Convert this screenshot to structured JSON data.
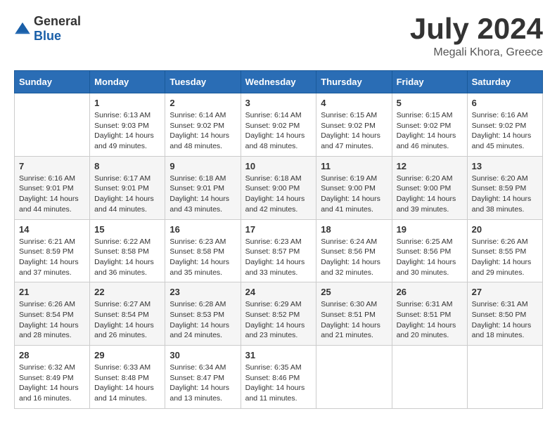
{
  "header": {
    "logo": {
      "general": "General",
      "blue": "Blue"
    },
    "title": "July 2024",
    "location": "Megali Khora, Greece"
  },
  "weekdays": [
    "Sunday",
    "Monday",
    "Tuesday",
    "Wednesday",
    "Thursday",
    "Friday",
    "Saturday"
  ],
  "weeks": [
    [
      {
        "day": "",
        "sunrise": "",
        "sunset": "",
        "daylight": ""
      },
      {
        "day": "1",
        "sunrise": "Sunrise: 6:13 AM",
        "sunset": "Sunset: 9:03 PM",
        "daylight": "Daylight: 14 hours and 49 minutes."
      },
      {
        "day": "2",
        "sunrise": "Sunrise: 6:14 AM",
        "sunset": "Sunset: 9:02 PM",
        "daylight": "Daylight: 14 hours and 48 minutes."
      },
      {
        "day": "3",
        "sunrise": "Sunrise: 6:14 AM",
        "sunset": "Sunset: 9:02 PM",
        "daylight": "Daylight: 14 hours and 48 minutes."
      },
      {
        "day": "4",
        "sunrise": "Sunrise: 6:15 AM",
        "sunset": "Sunset: 9:02 PM",
        "daylight": "Daylight: 14 hours and 47 minutes."
      },
      {
        "day": "5",
        "sunrise": "Sunrise: 6:15 AM",
        "sunset": "Sunset: 9:02 PM",
        "daylight": "Daylight: 14 hours and 46 minutes."
      },
      {
        "day": "6",
        "sunrise": "Sunrise: 6:16 AM",
        "sunset": "Sunset: 9:02 PM",
        "daylight": "Daylight: 14 hours and 45 minutes."
      }
    ],
    [
      {
        "day": "7",
        "sunrise": "Sunrise: 6:16 AM",
        "sunset": "Sunset: 9:01 PM",
        "daylight": "Daylight: 14 hours and 44 minutes."
      },
      {
        "day": "8",
        "sunrise": "Sunrise: 6:17 AM",
        "sunset": "Sunset: 9:01 PM",
        "daylight": "Daylight: 14 hours and 44 minutes."
      },
      {
        "day": "9",
        "sunrise": "Sunrise: 6:18 AM",
        "sunset": "Sunset: 9:01 PM",
        "daylight": "Daylight: 14 hours and 43 minutes."
      },
      {
        "day": "10",
        "sunrise": "Sunrise: 6:18 AM",
        "sunset": "Sunset: 9:00 PM",
        "daylight": "Daylight: 14 hours and 42 minutes."
      },
      {
        "day": "11",
        "sunrise": "Sunrise: 6:19 AM",
        "sunset": "Sunset: 9:00 PM",
        "daylight": "Daylight: 14 hours and 41 minutes."
      },
      {
        "day": "12",
        "sunrise": "Sunrise: 6:20 AM",
        "sunset": "Sunset: 9:00 PM",
        "daylight": "Daylight: 14 hours and 39 minutes."
      },
      {
        "day": "13",
        "sunrise": "Sunrise: 6:20 AM",
        "sunset": "Sunset: 8:59 PM",
        "daylight": "Daylight: 14 hours and 38 minutes."
      }
    ],
    [
      {
        "day": "14",
        "sunrise": "Sunrise: 6:21 AM",
        "sunset": "Sunset: 8:59 PM",
        "daylight": "Daylight: 14 hours and 37 minutes."
      },
      {
        "day": "15",
        "sunrise": "Sunrise: 6:22 AM",
        "sunset": "Sunset: 8:58 PM",
        "daylight": "Daylight: 14 hours and 36 minutes."
      },
      {
        "day": "16",
        "sunrise": "Sunrise: 6:23 AM",
        "sunset": "Sunset: 8:58 PM",
        "daylight": "Daylight: 14 hours and 35 minutes."
      },
      {
        "day": "17",
        "sunrise": "Sunrise: 6:23 AM",
        "sunset": "Sunset: 8:57 PM",
        "daylight": "Daylight: 14 hours and 33 minutes."
      },
      {
        "day": "18",
        "sunrise": "Sunrise: 6:24 AM",
        "sunset": "Sunset: 8:56 PM",
        "daylight": "Daylight: 14 hours and 32 minutes."
      },
      {
        "day": "19",
        "sunrise": "Sunrise: 6:25 AM",
        "sunset": "Sunset: 8:56 PM",
        "daylight": "Daylight: 14 hours and 30 minutes."
      },
      {
        "day": "20",
        "sunrise": "Sunrise: 6:26 AM",
        "sunset": "Sunset: 8:55 PM",
        "daylight": "Daylight: 14 hours and 29 minutes."
      }
    ],
    [
      {
        "day": "21",
        "sunrise": "Sunrise: 6:26 AM",
        "sunset": "Sunset: 8:54 PM",
        "daylight": "Daylight: 14 hours and 28 minutes."
      },
      {
        "day": "22",
        "sunrise": "Sunrise: 6:27 AM",
        "sunset": "Sunset: 8:54 PM",
        "daylight": "Daylight: 14 hours and 26 minutes."
      },
      {
        "day": "23",
        "sunrise": "Sunrise: 6:28 AM",
        "sunset": "Sunset: 8:53 PM",
        "daylight": "Daylight: 14 hours and 24 minutes."
      },
      {
        "day": "24",
        "sunrise": "Sunrise: 6:29 AM",
        "sunset": "Sunset: 8:52 PM",
        "daylight": "Daylight: 14 hours and 23 minutes."
      },
      {
        "day": "25",
        "sunrise": "Sunrise: 6:30 AM",
        "sunset": "Sunset: 8:51 PM",
        "daylight": "Daylight: 14 hours and 21 minutes."
      },
      {
        "day": "26",
        "sunrise": "Sunrise: 6:31 AM",
        "sunset": "Sunset: 8:51 PM",
        "daylight": "Daylight: 14 hours and 20 minutes."
      },
      {
        "day": "27",
        "sunrise": "Sunrise: 6:31 AM",
        "sunset": "Sunset: 8:50 PM",
        "daylight": "Daylight: 14 hours and 18 minutes."
      }
    ],
    [
      {
        "day": "28",
        "sunrise": "Sunrise: 6:32 AM",
        "sunset": "Sunset: 8:49 PM",
        "daylight": "Daylight: 14 hours and 16 minutes."
      },
      {
        "day": "29",
        "sunrise": "Sunrise: 6:33 AM",
        "sunset": "Sunset: 8:48 PM",
        "daylight": "Daylight: 14 hours and 14 minutes."
      },
      {
        "day": "30",
        "sunrise": "Sunrise: 6:34 AM",
        "sunset": "Sunset: 8:47 PM",
        "daylight": "Daylight: 14 hours and 13 minutes."
      },
      {
        "day": "31",
        "sunrise": "Sunrise: 6:35 AM",
        "sunset": "Sunset: 8:46 PM",
        "daylight": "Daylight: 14 hours and 11 minutes."
      },
      {
        "day": "",
        "sunrise": "",
        "sunset": "",
        "daylight": ""
      },
      {
        "day": "",
        "sunrise": "",
        "sunset": "",
        "daylight": ""
      },
      {
        "day": "",
        "sunrise": "",
        "sunset": "",
        "daylight": ""
      }
    ]
  ]
}
